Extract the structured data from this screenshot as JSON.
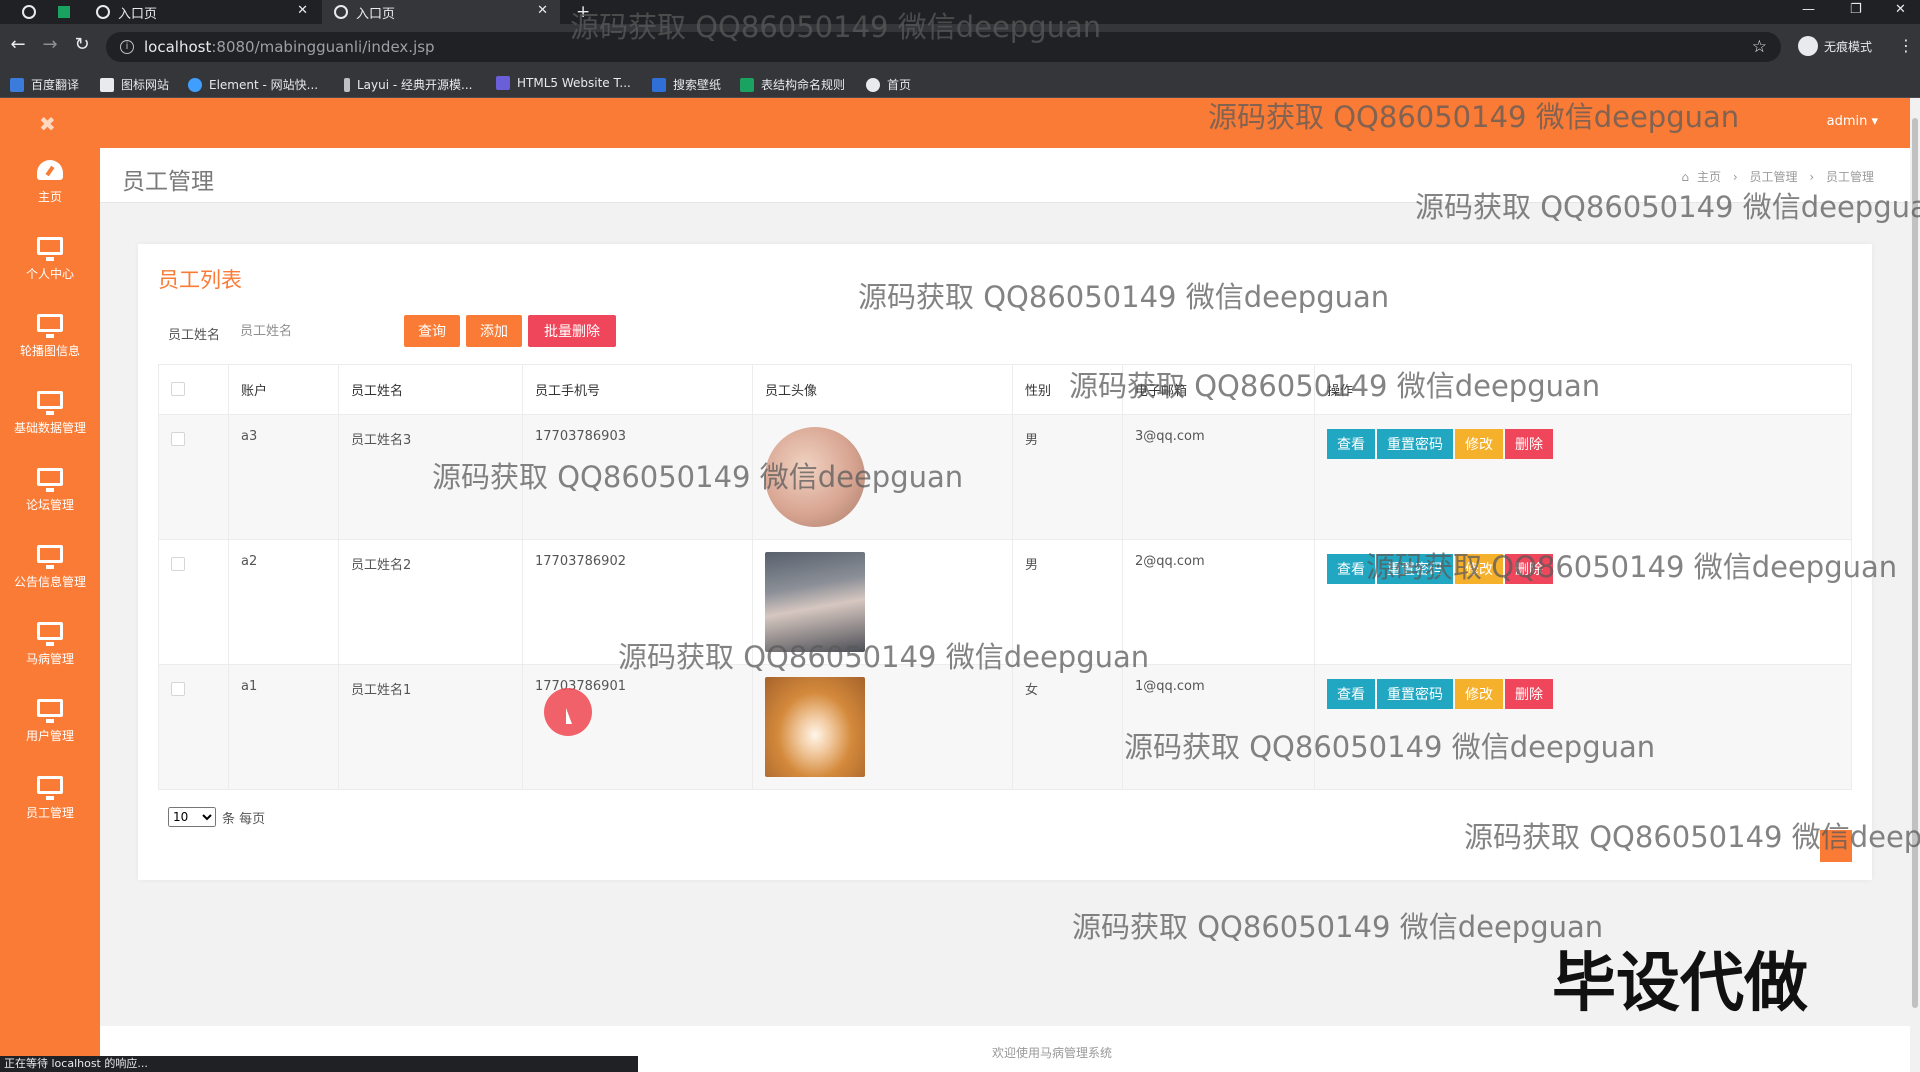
{
  "browser": {
    "tabs": [
      {
        "label": "入口页"
      },
      {
        "label": "入口页"
      }
    ],
    "new_tab": "+",
    "url_host": "localhost",
    "url_path": ":8080/mabingguanli/index.jsp",
    "incognito_label": "无痕模式",
    "bookmarks": [
      "百度翻译",
      "图标网站",
      "Element - 网站快...",
      "Layui - 经典开源模...",
      "HTML5 Website T...",
      "搜索壁纸",
      "表结构命名规则",
      "首页"
    ],
    "status_text": "正在等待 localhost 的响应..."
  },
  "header": {
    "user_label": "admin ▾"
  },
  "sidebar": {
    "items": [
      {
        "label": "主页",
        "icon": "dashboard-icon"
      },
      {
        "label": "个人中心",
        "icon": "monitor-icon"
      },
      {
        "label": "轮播图信息",
        "icon": "monitor-icon"
      },
      {
        "label": "基础数据管理",
        "icon": "monitor-icon"
      },
      {
        "label": "论坛管理",
        "icon": "monitor-icon"
      },
      {
        "label": "公告信息管理",
        "icon": "monitor-icon"
      },
      {
        "label": "马病管理",
        "icon": "monitor-icon"
      },
      {
        "label": "用户管理",
        "icon": "monitor-icon"
      },
      {
        "label": "员工管理",
        "icon": "monitor-icon"
      }
    ]
  },
  "page": {
    "title": "员工管理",
    "breadcrumb": [
      "主页",
      "员工管理",
      "员工管理"
    ]
  },
  "list": {
    "title": "员工列表",
    "search_label": "员工姓名",
    "search_placeholder": "员工姓名",
    "buttons": {
      "query": "查询",
      "add": "添加",
      "batch_delete": "批量删除"
    },
    "columns": [
      "账户",
      "员工姓名",
      "员工手机号",
      "员工头像",
      "性别",
      "电子邮箱",
      "操作"
    ],
    "rows": [
      {
        "account": "a3",
        "name": "员工姓名3",
        "phone": "17703786903",
        "gender": "男",
        "email": "3@qq.com"
      },
      {
        "account": "a2",
        "name": "员工姓名2",
        "phone": "17703786902",
        "gender": "男",
        "email": "2@qq.com"
      },
      {
        "account": "a1",
        "name": "员工姓名1",
        "phone": "17703786901",
        "gender": "女",
        "email": "1@qq.com"
      }
    ],
    "actions": {
      "view": "查看",
      "reset": "重置密码",
      "edit": "修改",
      "delete": "删除"
    },
    "page_size": "10",
    "page_size_suffix": "条 每页"
  },
  "footer": {
    "text": "欢迎使用马病管理系统"
  },
  "watermarks": {
    "text": "源码获取 QQ86050149 微信deepguan",
    "big": "毕设代做"
  },
  "colors": {
    "primary": "#fa7b35",
    "danger": "#f0465b",
    "info": "#21a7c2",
    "warning": "#f6b12c"
  }
}
